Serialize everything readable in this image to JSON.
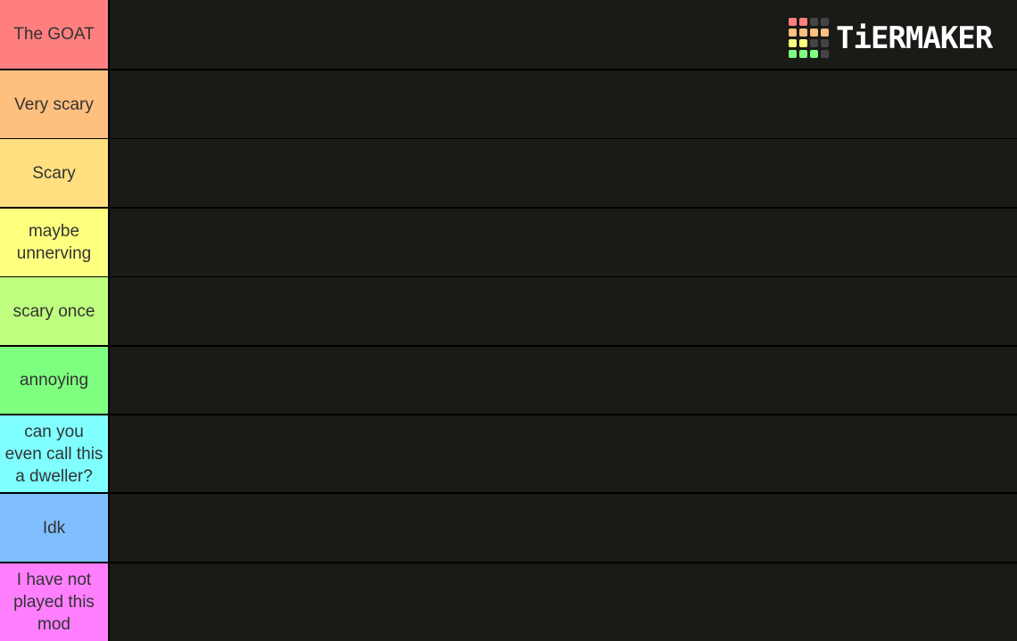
{
  "tiers": [
    {
      "label": "The GOAT",
      "color": "#ff7f7f"
    },
    {
      "label": "Very scary",
      "color": "#ffbf7f"
    },
    {
      "label": "Scary",
      "color": "#ffdf7f"
    },
    {
      "label": "maybe unnerving",
      "color": "#ffff7f"
    },
    {
      "label": "scary once",
      "color": "#bfff7f"
    },
    {
      "label": "annoying",
      "color": "#7fff7f"
    },
    {
      "label": "can you even call this a dweller?",
      "color": "#7fffff"
    },
    {
      "label": "Idk",
      "color": "#7fbfff"
    },
    {
      "label": "I have not played this mod",
      "color": "#ff7fff"
    }
  ],
  "logo": {
    "text": "TiERMAKER",
    "grid_colors": [
      "#ff7f7f",
      "#ff7f7f",
      "#444",
      "#444",
      "#ffbf7f",
      "#ffbf7f",
      "#ffbf7f",
      "#ffbf7f",
      "#ffff7f",
      "#ffff7f",
      "#444",
      "#444",
      "#7fff7f",
      "#7fff7f",
      "#7fff7f",
      "#444"
    ]
  }
}
